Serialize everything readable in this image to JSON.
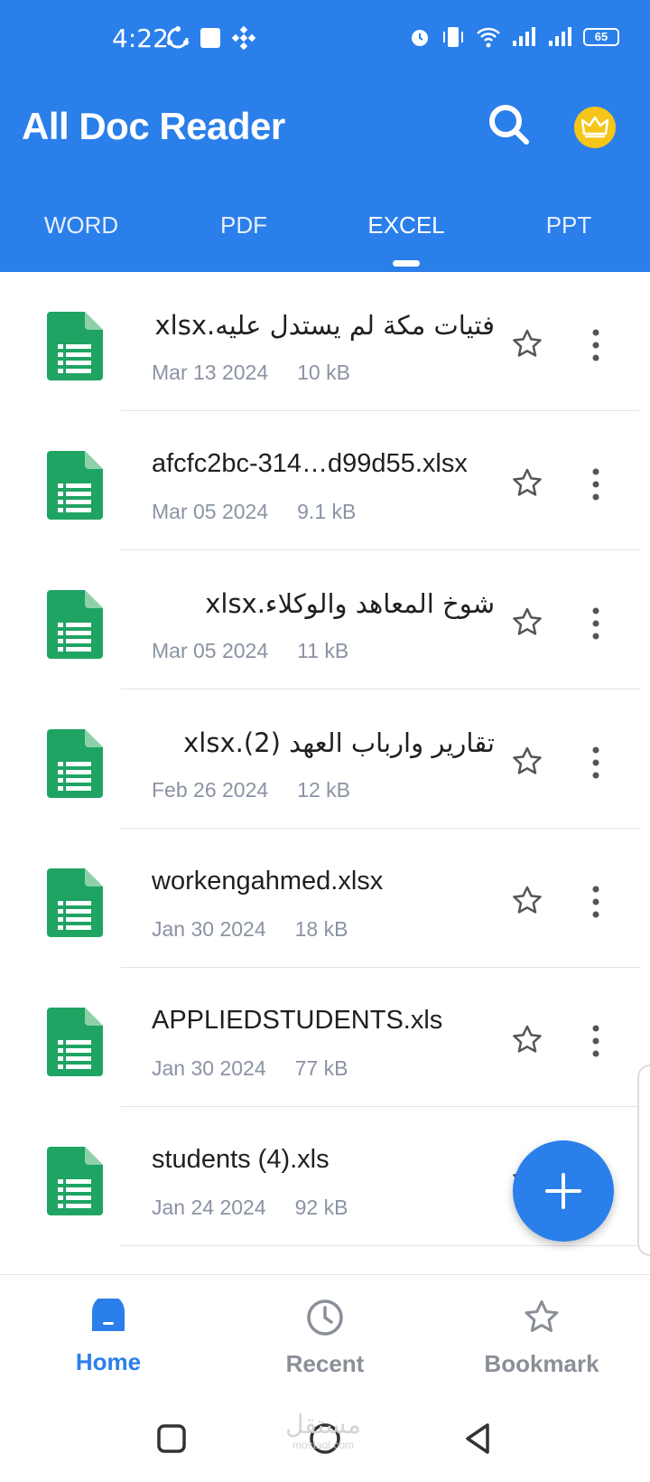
{
  "status_bar": {
    "time": "4:22",
    "battery": "65"
  },
  "header": {
    "title": "All Doc Reader"
  },
  "tabs": [
    {
      "label": "WORD"
    },
    {
      "label": "PDF"
    },
    {
      "label": "EXCEL",
      "active": true
    },
    {
      "label": "PPT"
    }
  ],
  "files": [
    {
      "name": "فتيات مكة لم يستدل عليه.xlsx",
      "date": "Mar 13 2024",
      "size": "10 kB",
      "rtl": true
    },
    {
      "name": "afcfc2bc-314…d99d55.xlsx",
      "date": "Mar 05 2024",
      "size": "9.1 kB",
      "rtl": false
    },
    {
      "name": "شوخ المعاهد والوكلاء.xlsx",
      "date": "Mar 05 2024",
      "size": "11 kB",
      "rtl": true
    },
    {
      "name": "تقارير وارباب العهد (2).xlsx",
      "date": "Feb 26 2024",
      "size": "12 kB",
      "rtl": true
    },
    {
      "name": "workengahmed.xlsx",
      "date": "Jan 30 2024",
      "size": "18 kB",
      "rtl": false
    },
    {
      "name": "APPLIEDSTUDENTS.xls",
      "date": "Jan 30 2024",
      "size": "77 kB",
      "rtl": false
    },
    {
      "name": "students (4).xls",
      "date": "Jan 24 2024",
      "size": "92 kB",
      "rtl": false
    }
  ],
  "bottom_nav": [
    {
      "label": "Home",
      "icon": "home-icon",
      "active": true
    },
    {
      "label": "Recent",
      "icon": "clock-icon"
    },
    {
      "label": "Bookmark",
      "icon": "star-icon"
    }
  ],
  "watermark": {
    "arabic": "مستقل",
    "latin": "mostaql.com"
  },
  "colors": {
    "primary": "#2a7fea",
    "file_green": "#1fa463",
    "crown": "#f5c518"
  }
}
